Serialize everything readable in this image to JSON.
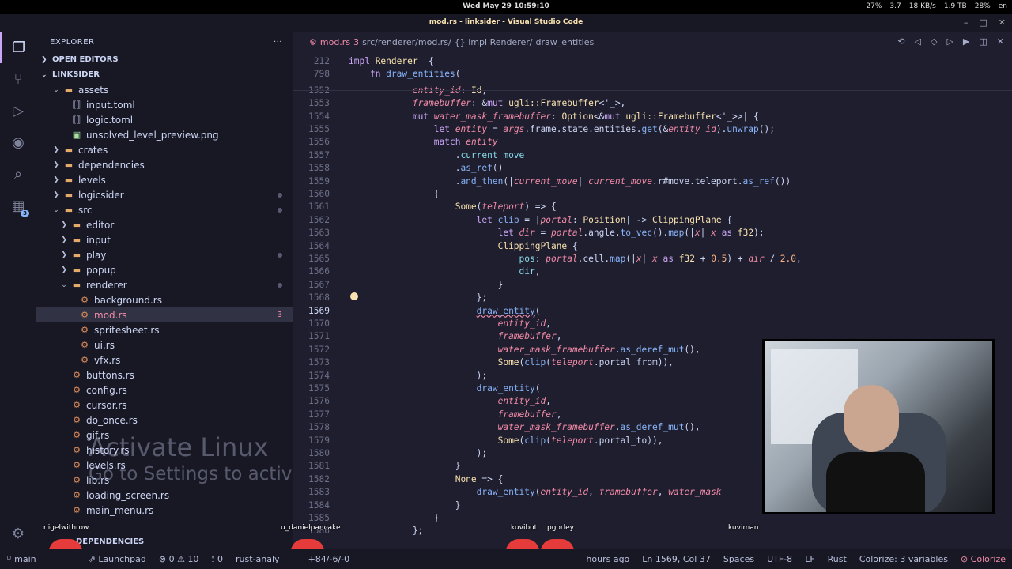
{
  "os_bar": {
    "clock": "Wed May 29 10:59:10",
    "stats": [
      "27%",
      "3.7",
      "18 KB/s",
      "1.9 TB",
      "28%",
      "en"
    ]
  },
  "window": {
    "title": "mod.rs - linksider - Visual Studio Code"
  },
  "activity_bar": {
    "extensions_badge": "3"
  },
  "explorer": {
    "title": "EXPLORER",
    "open_editors": "OPEN EDITORS",
    "project": "LINKSIDER",
    "tree": [
      {
        "label": "assets",
        "kind": "folder-open",
        "depth": 1
      },
      {
        "label": "input.toml",
        "kind": "toml",
        "depth": 2
      },
      {
        "label": "logic.toml",
        "kind": "toml",
        "depth": 2
      },
      {
        "label": "unsolved_level_preview.png",
        "kind": "png",
        "depth": 2
      },
      {
        "label": "crates",
        "kind": "folder",
        "depth": 1
      },
      {
        "label": "dependencies",
        "kind": "folder",
        "depth": 1
      },
      {
        "label": "levels",
        "kind": "folder",
        "depth": 1
      },
      {
        "label": "logicsider",
        "kind": "folder",
        "depth": 1,
        "dot": true
      },
      {
        "label": "src",
        "kind": "folder-open",
        "depth": 1,
        "dot": true
      },
      {
        "label": "editor",
        "kind": "folder",
        "depth": 2
      },
      {
        "label": "input",
        "kind": "folder",
        "depth": 2
      },
      {
        "label": "play",
        "kind": "folder",
        "depth": 2,
        "dot": true
      },
      {
        "label": "popup",
        "kind": "folder",
        "depth": 2
      },
      {
        "label": "renderer",
        "kind": "folder-open",
        "depth": 2,
        "dot": true
      },
      {
        "label": "background.rs",
        "kind": "rs",
        "depth": 3
      },
      {
        "label": "mod.rs",
        "kind": "rs",
        "depth": 3,
        "selected": true,
        "count": "3"
      },
      {
        "label": "spritesheet.rs",
        "kind": "rs",
        "depth": 3
      },
      {
        "label": "ui.rs",
        "kind": "rs",
        "depth": 3
      },
      {
        "label": "vfx.rs",
        "kind": "rs",
        "depth": 3
      },
      {
        "label": "buttons.rs",
        "kind": "rs",
        "depth": 2
      },
      {
        "label": "config.rs",
        "kind": "rs",
        "depth": 2
      },
      {
        "label": "cursor.rs",
        "kind": "rs",
        "depth": 2
      },
      {
        "label": "do_once.rs",
        "kind": "rs",
        "depth": 2
      },
      {
        "label": "gif.rs",
        "kind": "rs",
        "depth": 2
      },
      {
        "label": "history.rs",
        "kind": "rs",
        "depth": 2
      },
      {
        "label": "levels.rs",
        "kind": "rs",
        "depth": 2
      },
      {
        "label": "lib.rs",
        "kind": "rs",
        "depth": 2
      },
      {
        "label": "loading_screen.rs",
        "kind": "rs",
        "depth": 2
      },
      {
        "label": "main_menu.rs",
        "kind": "rs",
        "depth": 2
      }
    ],
    "dependencies_section": "DEPENDENCIES"
  },
  "watermark": {
    "line1": "Activate Linux",
    "line2": "Go to Settings to activate Linux"
  },
  "breadcrumb": {
    "file": "mod.rs",
    "count": "3",
    "path": "src/renderer/mod.rs/",
    "impl": "{} impl Renderer/",
    "fn": "draw_entities"
  },
  "code": [
    {
      "no": "212",
      "sticky": true,
      "segs": [
        [
          "k",
          "impl "
        ],
        [
          "t",
          "Renderer"
        ],
        [
          "",
          "  {"
        ]
      ]
    },
    {
      "no": "798",
      "sticky": true,
      "segs": [
        [
          "",
          "    "
        ],
        [
          "k",
          "fn "
        ],
        [
          "f",
          "draw_entities"
        ],
        [
          "",
          "("
        ]
      ]
    },
    {
      "no": "1552",
      "segs": [
        [
          "",
          "            "
        ],
        [
          "v",
          "entity_id"
        ],
        [
          "",
          ": "
        ],
        [
          "t",
          "Id"
        ],
        [
          "",
          ","
        ]
      ]
    },
    {
      "no": "1553",
      "segs": [
        [
          "",
          "            "
        ],
        [
          "v",
          "framebuffer"
        ],
        [
          "",
          ": &"
        ],
        [
          "k",
          "mut "
        ],
        [
          "t",
          "ugli::Framebuffer"
        ],
        [
          "",
          "<'_>,"
        ]
      ]
    },
    {
      "no": "1554",
      "segs": [
        [
          "",
          "            "
        ],
        [
          "k",
          "mut "
        ],
        [
          "v",
          "water_mask_framebuffer"
        ],
        [
          "",
          ": "
        ],
        [
          "t",
          "Option"
        ],
        [
          "",
          "<&"
        ],
        [
          "k",
          "mut "
        ],
        [
          "t",
          "ugli::Framebuffer"
        ],
        [
          "",
          "<'_>>| {"
        ]
      ]
    },
    {
      "no": "1555",
      "segs": [
        [
          "",
          "                "
        ],
        [
          "k",
          "let "
        ],
        [
          "v",
          "entity"
        ],
        [
          "",
          " = "
        ],
        [
          "v",
          "args"
        ],
        [
          "",
          ".frame.state.entities."
        ],
        [
          "f",
          "get"
        ],
        [
          "",
          "(&"
        ],
        [
          "v",
          "entity_id"
        ],
        [
          "",
          ")."
        ],
        [
          "f",
          "unwrap"
        ],
        [
          "",
          "();"
        ]
      ]
    },
    {
      "no": "1556",
      "segs": [
        [
          "",
          "                "
        ],
        [
          "k",
          "match "
        ],
        [
          "v",
          "entity"
        ]
      ]
    },
    {
      "no": "1557",
      "segs": [
        [
          "",
          "                    ."
        ],
        [
          "m",
          "current_move"
        ]
      ]
    },
    {
      "no": "1558",
      "segs": [
        [
          "",
          "                    ."
        ],
        [
          "f",
          "as_ref"
        ],
        [
          "",
          "()"
        ]
      ]
    },
    {
      "no": "1559",
      "segs": [
        [
          "",
          "                    ."
        ],
        [
          "f",
          "and_then"
        ],
        [
          "",
          "(|"
        ],
        [
          "v",
          "current_move"
        ],
        [
          "",
          "| "
        ],
        [
          "v",
          "current_move"
        ],
        [
          "",
          ".r#move.teleport."
        ],
        [
          "f",
          "as_ref"
        ],
        [
          "",
          "())"
        ]
      ]
    },
    {
      "no": "1560",
      "segs": [
        [
          "",
          "                {"
        ]
      ]
    },
    {
      "no": "1561",
      "segs": [
        [
          "",
          "                    "
        ],
        [
          "t",
          "Some"
        ],
        [
          "",
          "("
        ],
        [
          "v",
          "teleport"
        ],
        [
          "",
          ") => {"
        ]
      ]
    },
    {
      "no": "1562",
      "segs": [
        [
          "",
          "                        "
        ],
        [
          "k",
          "let "
        ],
        [
          "f",
          "clip"
        ],
        [
          "",
          " = |"
        ],
        [
          "v",
          "portal"
        ],
        [
          "",
          ": "
        ],
        [
          "t",
          "Position"
        ],
        [
          "",
          "| -> "
        ],
        [
          "t",
          "ClippingPlane"
        ],
        [
          "",
          " {"
        ]
      ]
    },
    {
      "no": "1563",
      "segs": [
        [
          "",
          "                            "
        ],
        [
          "k",
          "let "
        ],
        [
          "v",
          "dir"
        ],
        [
          "",
          " = "
        ],
        [
          "v",
          "portal"
        ],
        [
          "",
          ".angle."
        ],
        [
          "f",
          "to_vec"
        ],
        [
          "",
          "()."
        ],
        [
          "f",
          "map"
        ],
        [
          "",
          "(|"
        ],
        [
          "v",
          "x"
        ],
        [
          "",
          "| "
        ],
        [
          "v",
          "x"
        ],
        [
          "",
          " "
        ],
        [
          "k",
          "as "
        ],
        [
          "t",
          "f32"
        ],
        [
          "",
          ");"
        ]
      ]
    },
    {
      "no": "1564",
      "segs": [
        [
          "",
          "                            "
        ],
        [
          "t",
          "ClippingPlane"
        ],
        [
          "",
          " {"
        ]
      ]
    },
    {
      "no": "1565",
      "segs": [
        [
          "",
          "                                "
        ],
        [
          "m",
          "pos"
        ],
        [
          "",
          ": "
        ],
        [
          "v",
          "portal"
        ],
        [
          "",
          ".cell."
        ],
        [
          "f",
          "map"
        ],
        [
          "",
          "(|"
        ],
        [
          "v",
          "x"
        ],
        [
          "",
          "| "
        ],
        [
          "v",
          "x"
        ],
        [
          "",
          " "
        ],
        [
          "k",
          "as "
        ],
        [
          "t",
          "f32"
        ],
        [
          "",
          " + "
        ],
        [
          "n",
          "0.5"
        ],
        [
          "",
          ") + "
        ],
        [
          "v",
          "dir"
        ],
        [
          "",
          " / "
        ],
        [
          "n",
          "2.0"
        ],
        [
          "",
          ","
        ]
      ]
    },
    {
      "no": "1566",
      "segs": [
        [
          "",
          "                                "
        ],
        [
          "m",
          "dir"
        ],
        [
          "",
          ","
        ]
      ]
    },
    {
      "no": "1567",
      "segs": [
        [
          "",
          "                            }"
        ]
      ]
    },
    {
      "no": "1568",
      "segs": [
        [
          "",
          "                        };"
        ]
      ]
    },
    {
      "no": "1569",
      "current": true,
      "segs": [
        [
          "",
          "                        "
        ],
        [
          "f err",
          "draw_entity"
        ],
        [
          "",
          "("
        ]
      ]
    },
    {
      "no": "1570",
      "segs": [
        [
          "",
          "                            "
        ],
        [
          "v",
          "entity_id"
        ],
        [
          "",
          ","
        ]
      ]
    },
    {
      "no": "1571",
      "segs": [
        [
          "",
          "                            "
        ],
        [
          "v",
          "framebuffer"
        ],
        [
          "",
          ","
        ]
      ]
    },
    {
      "no": "1572",
      "segs": [
        [
          "",
          "                            "
        ],
        [
          "v",
          "water_mask_framebuffer"
        ],
        [
          "",
          "."
        ],
        [
          "f",
          "as_deref_mut"
        ],
        [
          "",
          "(),"
        ]
      ]
    },
    {
      "no": "1573",
      "segs": [
        [
          "",
          "                            "
        ],
        [
          "t",
          "Some"
        ],
        [
          "",
          "("
        ],
        [
          "f",
          "clip"
        ],
        [
          "",
          "("
        ],
        [
          "v",
          "teleport"
        ],
        [
          "",
          ".portal_from)),"
        ]
      ]
    },
    {
      "no": "1574",
      "segs": [
        [
          "",
          "                        );"
        ]
      ]
    },
    {
      "no": "1575",
      "segs": [
        [
          "",
          "                        "
        ],
        [
          "f",
          "draw_entity"
        ],
        [
          "",
          "("
        ]
      ]
    },
    {
      "no": "1576",
      "segs": [
        [
          "",
          "                            "
        ],
        [
          "v",
          "entity_id"
        ],
        [
          "",
          ","
        ]
      ]
    },
    {
      "no": "1577",
      "segs": [
        [
          "",
          "                            "
        ],
        [
          "v",
          "framebuffer"
        ],
        [
          "",
          ","
        ]
      ]
    },
    {
      "no": "1578",
      "segs": [
        [
          "",
          "                            "
        ],
        [
          "v",
          "water_mask_framebuffer"
        ],
        [
          "",
          "."
        ],
        [
          "f",
          "as_deref_mut"
        ],
        [
          "",
          "(),"
        ]
      ]
    },
    {
      "no": "1579",
      "segs": [
        [
          "",
          "                            "
        ],
        [
          "t",
          "Some"
        ],
        [
          "",
          "("
        ],
        [
          "f",
          "clip"
        ],
        [
          "",
          "("
        ],
        [
          "v",
          "teleport"
        ],
        [
          "",
          ".portal_to)),"
        ]
      ]
    },
    {
      "no": "1580",
      "segs": [
        [
          "",
          "                        );"
        ]
      ]
    },
    {
      "no": "1581",
      "segs": [
        [
          "",
          "                    }"
        ]
      ]
    },
    {
      "no": "1582",
      "segs": [
        [
          "",
          "                    "
        ],
        [
          "t",
          "None"
        ],
        [
          "",
          " => {"
        ]
      ]
    },
    {
      "no": "1583",
      "segs": [
        [
          "",
          "                        "
        ],
        [
          "f",
          "draw_entity"
        ],
        [
          "",
          "("
        ],
        [
          "v",
          "entity_id"
        ],
        [
          "",
          ", "
        ],
        [
          "v",
          "framebuffer"
        ],
        [
          "",
          ", "
        ],
        [
          "v",
          "water_mask"
        ]
      ]
    },
    {
      "no": "1584",
      "segs": [
        [
          "",
          "                    }"
        ]
      ]
    },
    {
      "no": "1585",
      "segs": [
        [
          "",
          "                }"
        ]
      ]
    },
    {
      "no": "1586",
      "segs": [
        [
          "",
          "            };"
        ]
      ]
    }
  ],
  "overlay_names": [
    "nigelwithrow",
    "u_danielpancake",
    "kuvibot",
    "pgorley",
    "kuviman"
  ],
  "status": {
    "branch": "main",
    "launchpad": "Launchpad",
    "errors": "0",
    "warnings": "10",
    "ports": "0",
    "analyzer": "rust-analy",
    "diff": "+84/-6/-0",
    "time_ago": "hours ago",
    "position": "Ln 1569, Col 37",
    "spaces": "Spaces",
    "encoding": "UTF-8",
    "eol": "LF",
    "language": "Rust",
    "colorize_vars": "Colorize: 3 variables",
    "colorize": "Colorize"
  },
  "colors": {
    "accent": "#cba6f7",
    "error": "#f38ba8",
    "background": "#1e1e2e"
  }
}
